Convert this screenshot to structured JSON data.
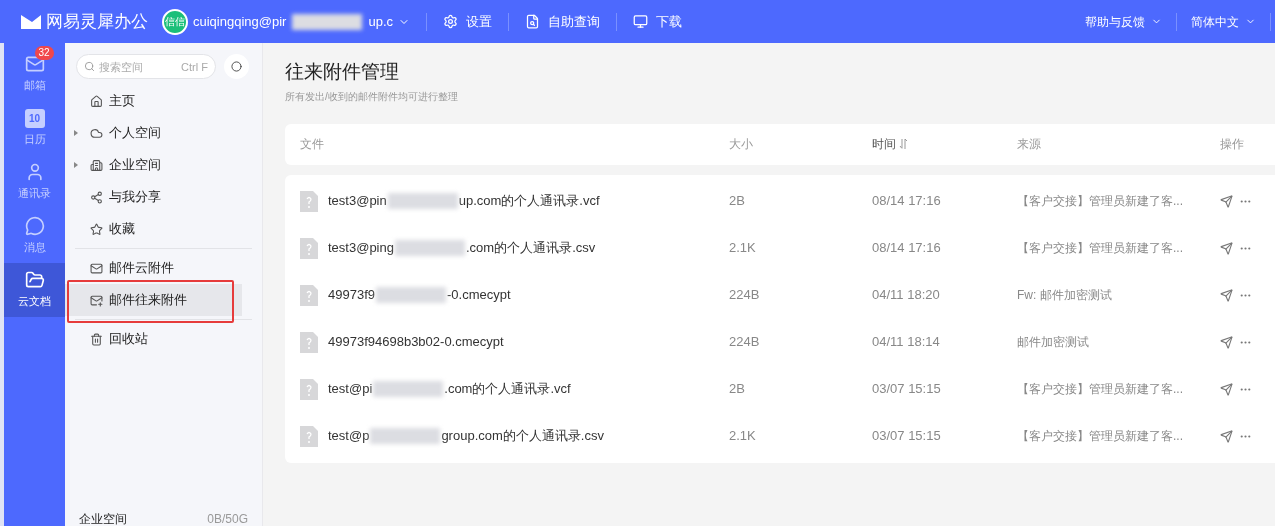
{
  "topbar": {
    "app_name": "网易灵犀办公",
    "account": {
      "avatar_text": "信信",
      "email_parts": [
        "cuiqingqing@pir",
        "up.c"
      ]
    },
    "menu": [
      {
        "kind": "settings",
        "label": "设置"
      },
      {
        "kind": "query",
        "label": "自助查询"
      },
      {
        "kind": "download",
        "label": "下载"
      }
    ],
    "right_menu": [
      {
        "label": "帮助与反馈"
      },
      {
        "label": "简体中文"
      }
    ]
  },
  "nav_rail": [
    {
      "kind": "mail",
      "label": "邮箱",
      "badge": "32",
      "selected": false
    },
    {
      "kind": "calendar",
      "label": "日历",
      "icon_text": "10",
      "selected": false
    },
    {
      "kind": "contacts",
      "label": "通讯录",
      "selected": false
    },
    {
      "kind": "message",
      "label": "消息",
      "selected": false
    },
    {
      "kind": "docs",
      "label": "云文档",
      "selected": true
    }
  ],
  "sidebar": {
    "search": {
      "placeholder": "搜索空间",
      "shortcut": "Ctrl F"
    },
    "groups": [
      [
        {
          "kind": "home",
          "label": "主页",
          "expandable": false,
          "selected": false
        },
        {
          "kind": "cloud",
          "label": "个人空间",
          "expandable": true,
          "selected": false
        },
        {
          "kind": "building",
          "label": "企业空间",
          "expandable": true,
          "selected": false
        },
        {
          "kind": "share",
          "label": "与我分享",
          "expandable": false,
          "selected": false
        },
        {
          "kind": "star",
          "label": "收藏",
          "expandable": false,
          "selected": false
        }
      ],
      [
        {
          "kind": "mail",
          "label": "邮件云附件",
          "expandable": false,
          "selected": false
        },
        {
          "kind": "mail-swap",
          "label": "邮件往来附件",
          "expandable": false,
          "selected": true
        }
      ],
      [
        {
          "kind": "trash",
          "label": "回收站",
          "expandable": false,
          "selected": false
        }
      ]
    ],
    "storage": {
      "label": "企业空间",
      "usage": "0B/50G"
    }
  },
  "main": {
    "title": "往来附件管理",
    "subtitle": "所有发出/收到的邮件附件均可进行整理",
    "columns": [
      "文件",
      "大小",
      "时间",
      "来源",
      "操作"
    ],
    "rows": [
      {
        "name_parts": [
          "test3@pin",
          "up.com的个人通讯录.vcf"
        ],
        "size": "2B",
        "time": "08/14 17:16",
        "source": "【客户交接】管理员新建了客..."
      },
      {
        "name_parts": [
          "test3@ping",
          ".com的个人通讯录.csv"
        ],
        "size": "2.1K",
        "time": "08/14 17:16",
        "source": "【客户交接】管理员新建了客..."
      },
      {
        "name_parts": [
          "49973f9",
          "-0.cmecypt"
        ],
        "size": "224B",
        "time": "04/11 18:20",
        "source": "Fw: 邮件加密测试"
      },
      {
        "name_parts": [
          "49973f94698b3b02-0.cmecypt"
        ],
        "size": "224B",
        "time": "04/11 18:14",
        "source": "邮件加密测试"
      },
      {
        "name_parts": [
          "test@pi",
          ".com的个人通讯录.vcf"
        ],
        "size": "2B",
        "time": "03/07 15:15",
        "source": "【客户交接】管理员新建了客..."
      },
      {
        "name_parts": [
          "test@p",
          "group.com的个人通讯录.csv"
        ],
        "size": "2.1K",
        "time": "03/07 15:15",
        "source": "【客户交接】管理员新建了客..."
      }
    ]
  }
}
